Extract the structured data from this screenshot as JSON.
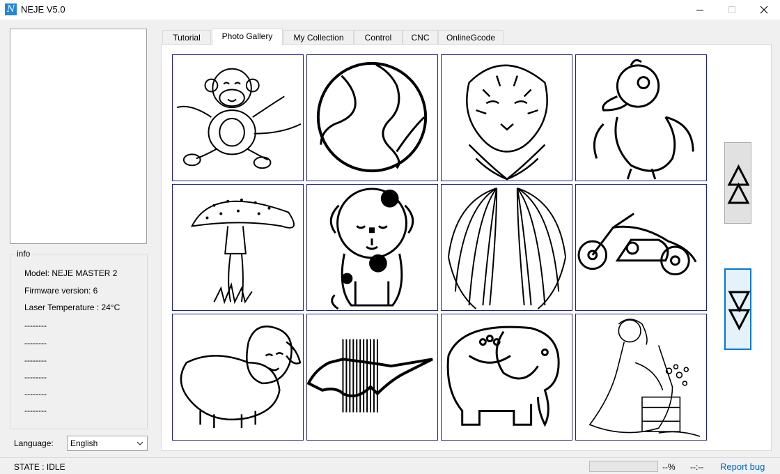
{
  "window": {
    "title": "NEJE V5.0",
    "icon_letter": "N"
  },
  "tabs": [
    {
      "label": "Tutorial"
    },
    {
      "label": "Photo Gallery"
    },
    {
      "label": "My Collection"
    },
    {
      "label": "Control"
    },
    {
      "label": "CNC"
    },
    {
      "label": "OnlineGcode"
    }
  ],
  "active_tab": "Photo Gallery",
  "gallery": [
    "monkey",
    "earth-globe",
    "tiger",
    "duckling",
    "mushroom",
    "puppy",
    "wings",
    "motorcycle",
    "sheep",
    "mustang-horse",
    "elephant",
    "cinderella"
  ],
  "info": {
    "legend": "info",
    "model": "Model: NEJE MASTER 2",
    "firmware": "Firmware version: 6",
    "laser_temp": "Laser Temperature : 24°C",
    "placeholders": [
      "--------",
      "--------",
      "--------",
      "--------",
      "--------",
      "--------"
    ]
  },
  "language": {
    "label": "Language:",
    "selected": "English"
  },
  "status": {
    "state": "STATE : IDLE",
    "progress_percent_text": "--%",
    "progress": 0,
    "time": "--:--",
    "report_bug": "Report bug"
  },
  "colors": {
    "accent": "#0078d7",
    "cell_border": "#1f1f8c",
    "link": "#0066cc"
  }
}
